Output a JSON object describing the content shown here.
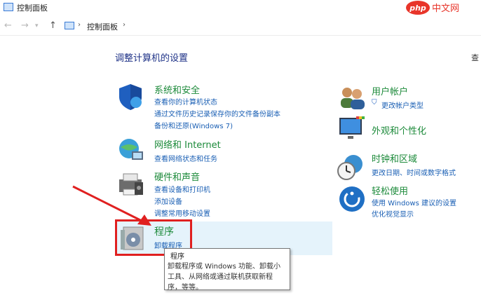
{
  "window": {
    "title": "控制面板",
    "watermark": "php中文网"
  },
  "address": {
    "crumb": "控制面板"
  },
  "heading": {
    "title": "调整计算机的设置",
    "view_by_cut": "查"
  },
  "left_categories": [
    {
      "title": "系统和安全",
      "links": [
        "查看你的计算机状态",
        "通过文件历史记录保存你的文件备份副本",
        "备份和还原(Windows 7)"
      ]
    },
    {
      "title": "网络和 Internet",
      "links": [
        "查看网络状态和任务"
      ]
    },
    {
      "title": "硬件和声音",
      "links": [
        "查看设备和打印机",
        "添加设备",
        "调整常用移动设置"
      ]
    },
    {
      "title": "程序",
      "links": [
        "卸载程序"
      ]
    }
  ],
  "right_categories": [
    {
      "title": "用户帐户",
      "links": [
        "更改帐户类型"
      ]
    },
    {
      "title": "外观和个性化",
      "links": []
    },
    {
      "title": "时钟和区域",
      "links": [
        "更改日期、时间或数字格式"
      ]
    },
    {
      "title": "轻松使用",
      "links": [
        "使用 Windows 建议的设置",
        "优化视觉显示"
      ]
    }
  ],
  "tooltip": {
    "title": "程序",
    "lines": [
      "卸载程序或 Windows 功能、卸载小",
      "工具、从网络或通过联机获取新程",
      "序，等等。"
    ]
  },
  "colors": {
    "accent_red": "#e02020",
    "link_blue": "#1a5fb4",
    "category_green": "#1c8a3a"
  }
}
